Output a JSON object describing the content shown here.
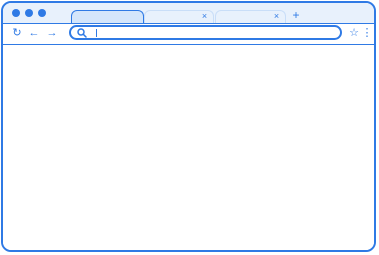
{
  "theme": {
    "accent": "#2f7ae5",
    "titlebar_bg": "#e8f1fc",
    "active_tab_bg": "#d4e6fb"
  },
  "window_controls": [
    "close-dot",
    "minimize-dot",
    "maximize-dot"
  ],
  "tabs": [
    {
      "label": "",
      "active": true
    },
    {
      "label": "",
      "active": false,
      "close_symbol": "×"
    },
    {
      "label": "",
      "active": false,
      "close_symbol": "×"
    }
  ],
  "new_tab_symbol": "+",
  "toolbar": {
    "reload_symbol": "↻",
    "back_symbol": "←",
    "forward_symbol": "→",
    "bookmark_symbol": "☆",
    "menu_symbol": "⋮"
  },
  "address_bar": {
    "value": "",
    "placeholder": ""
  },
  "page_content": {
    "text": ""
  }
}
